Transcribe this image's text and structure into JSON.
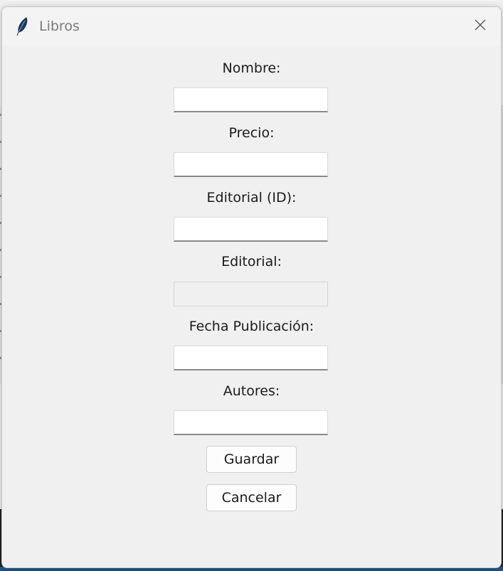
{
  "window": {
    "title": "Libros",
    "title_icon": "feather-icon",
    "close_icon": "close-icon"
  },
  "form": {
    "nombre": {
      "label": "Nombre:",
      "value": ""
    },
    "precio": {
      "label": "Precio:",
      "value": ""
    },
    "editorial_id": {
      "label": "Editorial (ID):",
      "value": ""
    },
    "editorial": {
      "label": "Editorial:",
      "value": "",
      "disabled": true
    },
    "fecha_publicacion": {
      "label": "Fecha Publicación:",
      "value": ""
    },
    "autores": {
      "label": "Autores:",
      "value": ""
    }
  },
  "buttons": {
    "save_label": "Guardar",
    "cancel_label": "Cancelar"
  }
}
